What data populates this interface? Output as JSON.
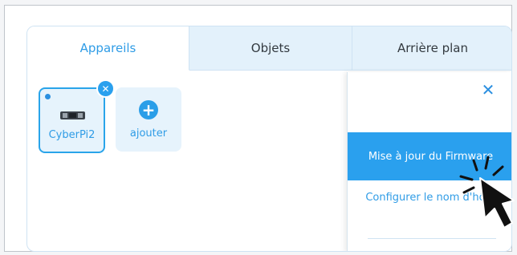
{
  "tabs": [
    {
      "label": "Appareils",
      "active": true
    },
    {
      "label": "Objets",
      "active": false
    },
    {
      "label": "Arrière plan",
      "active": false
    }
  ],
  "device": {
    "name": "CyberPi2",
    "icon": "cyberpi-board-icon",
    "status_icon": "connection-dot-icon",
    "remove_icon": "close-icon"
  },
  "add_device": {
    "label": "ajouter",
    "icon": "plus-icon"
  },
  "device_menu": {
    "close_icon": "close-icon",
    "items": [
      {
        "label": "Mise à jour du Firmware",
        "highlighted": true
      },
      {
        "label": "Configurer le nom d'hôte",
        "highlighted": false
      }
    ]
  },
  "colors": {
    "accent": "#2aa0ee",
    "tab_inactive_bg": "#e3f1fb",
    "card_bg": "#e6f3fc",
    "text_active": "#2f9ce6"
  }
}
